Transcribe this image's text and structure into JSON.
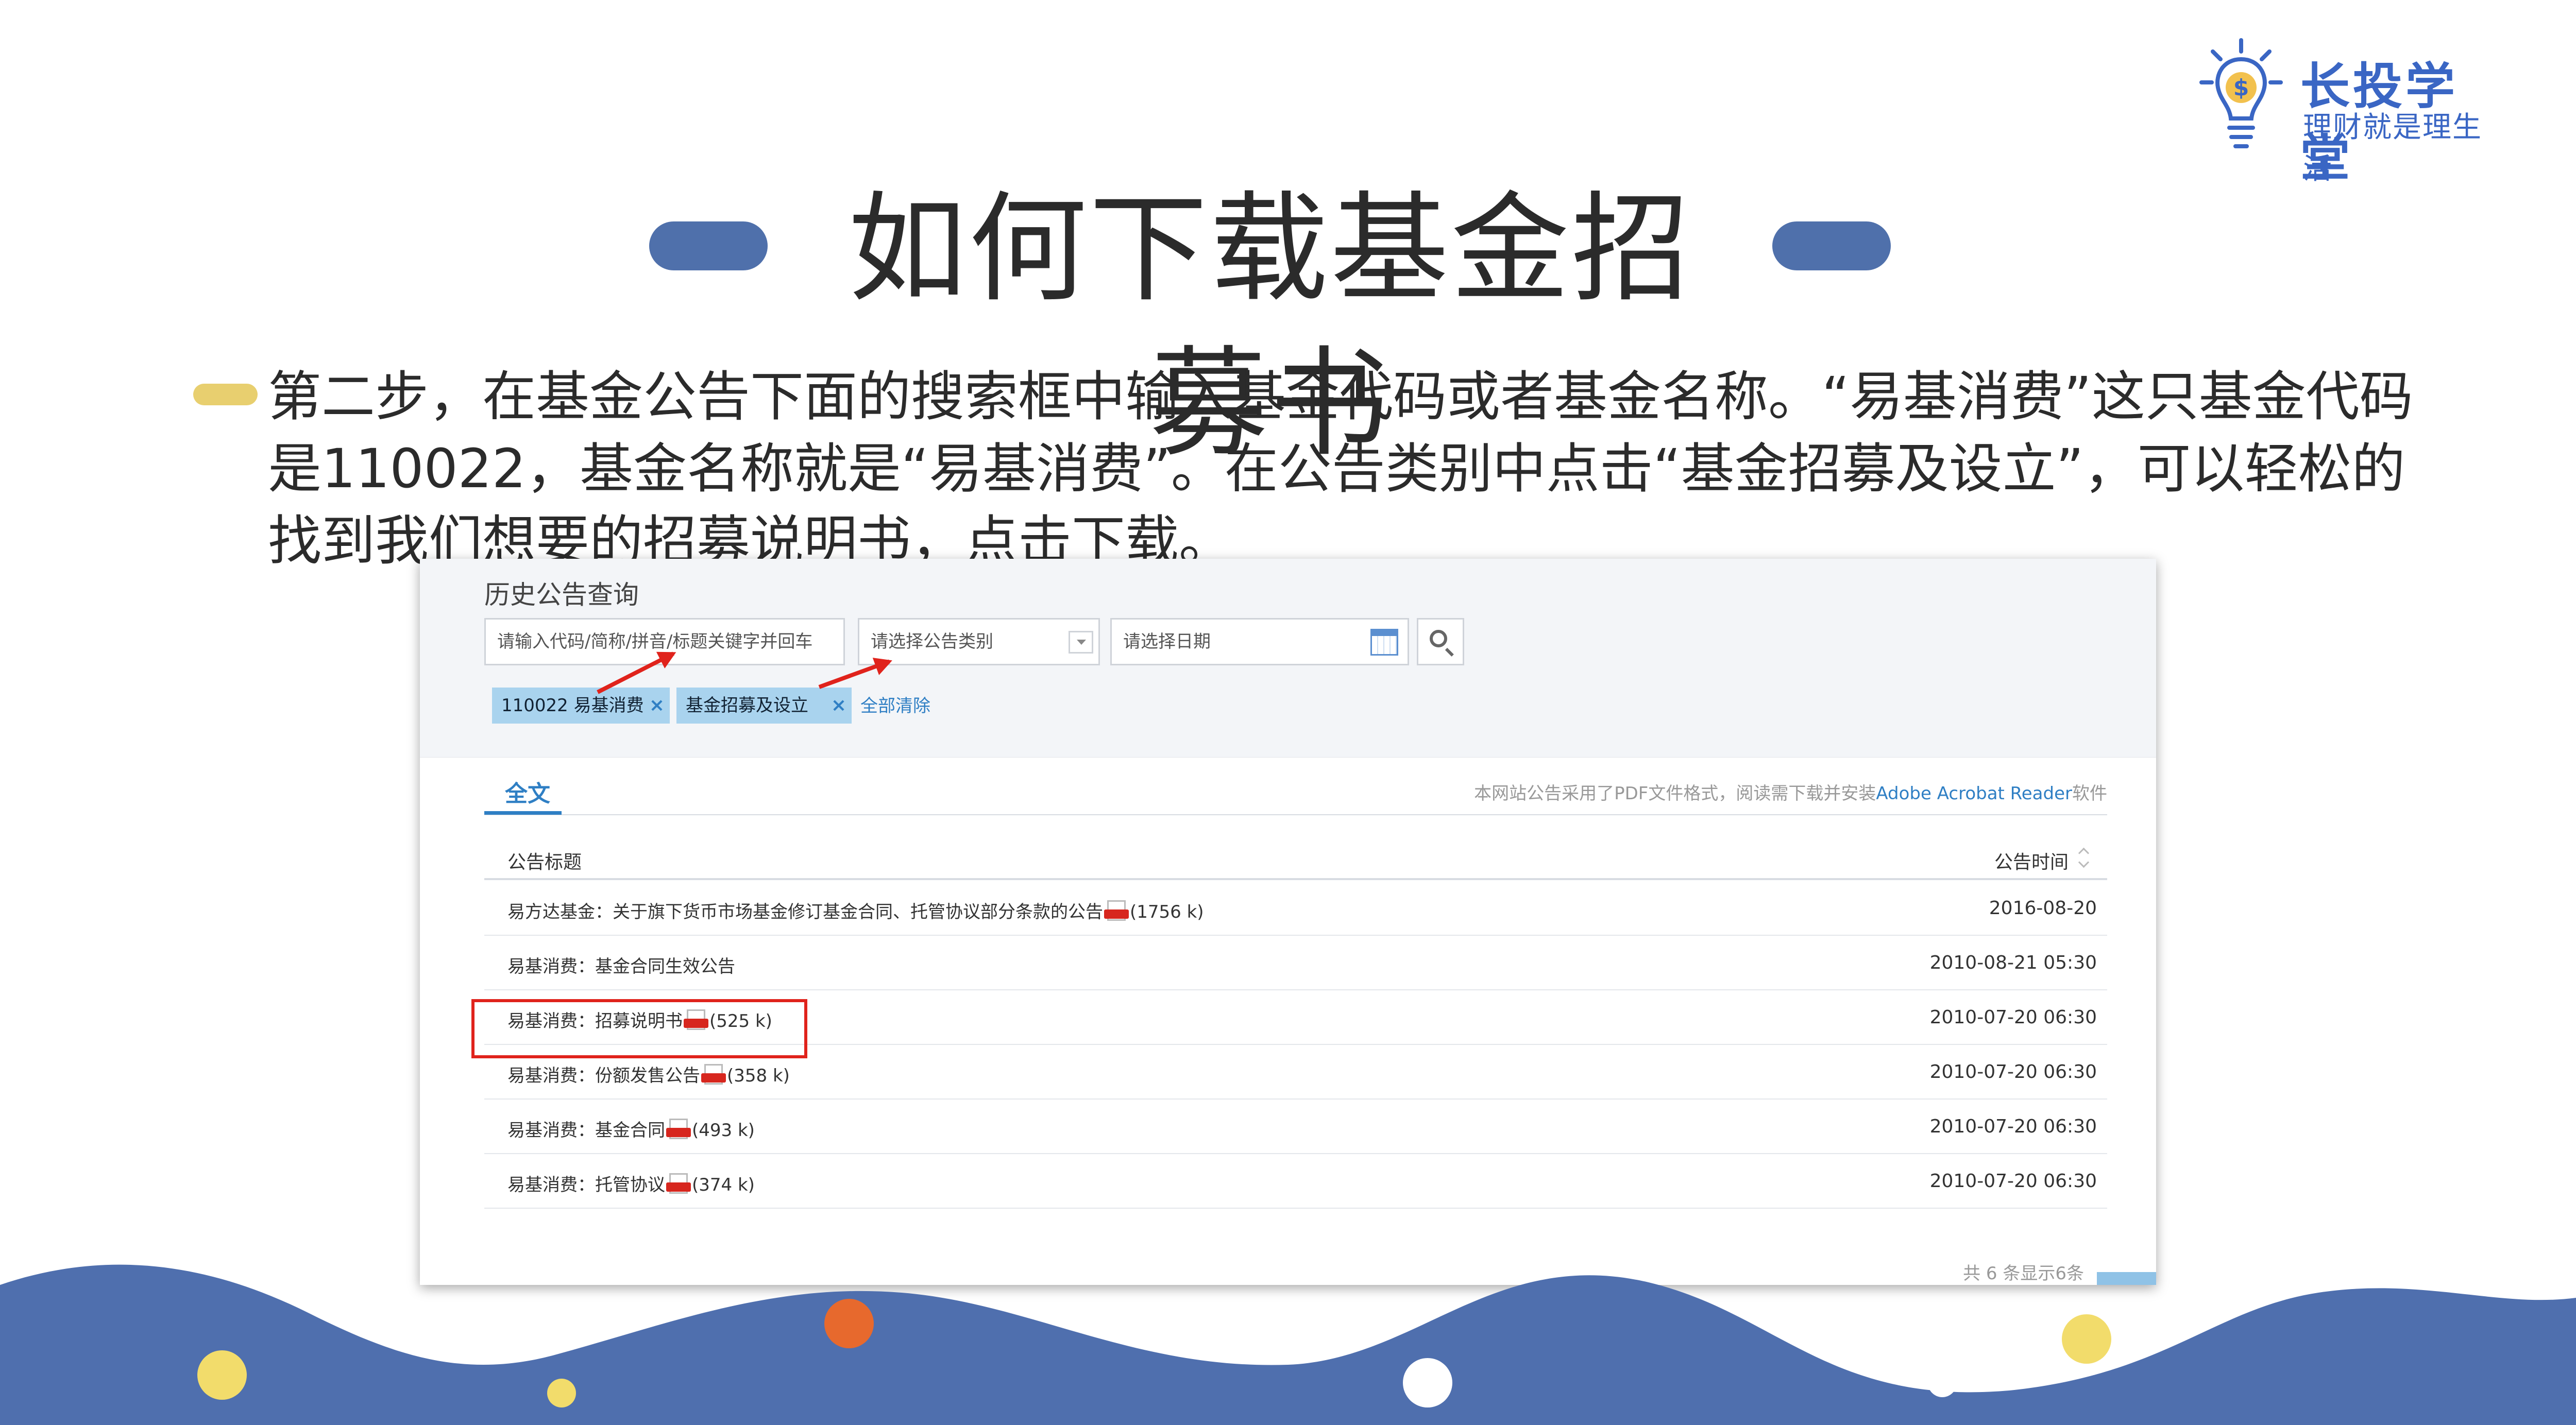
{
  "brand": {
    "name": "长投学堂",
    "slogan": "理财就是理生活"
  },
  "slide": {
    "title": "如何下载基金招募书",
    "intro": "第二步，在基金公告下面的搜索框中输入基金代码或者基金名称。“易基消费”这只基金代码是110022，基金名称就是“易基消费”。在公告类别中点击“基金招募及设立”，可以轻松的找到我们想要的招募说明书，点击下载。"
  },
  "search_panel": {
    "title": "历史公告查询",
    "code_placeholder": "请输入代码/简称/拼音/标题关键字并回车",
    "type_placeholder": "请选择公告类别",
    "date_placeholder": "请选择日期",
    "tags": [
      {
        "label": "110022 易基消费",
        "remove": "×"
      },
      {
        "label": "基金招募及设立",
        "remove": "×"
      }
    ],
    "clear_all": "全部清除"
  },
  "results": {
    "tab": "全文",
    "pdf_note": "本网站公告采用了PDF文件格式，阅读需下载并安装",
    "pdf_note_link": "Adobe Acrobat Reader",
    "pdf_note_suffix": "软件",
    "columns": {
      "title": "公告标题",
      "time": "公告时间"
    },
    "rows": [
      {
        "title": "易方达基金：关于旗下货币市场基金修订基金合同、托管协议部分条款的公告",
        "size": "(1756 k)",
        "time": "2016-08-20"
      },
      {
        "title": "易基消费：基金合同生效公告",
        "size": "",
        "time": "2010-08-21 05:30"
      },
      {
        "title": "易基消费：招募说明书",
        "size": "(525 k)",
        "time": "2010-07-20 06:30"
      },
      {
        "title": "易基消费：份额发售公告",
        "size": "(358 k)",
        "time": "2010-07-20 06:30"
      },
      {
        "title": "易基消费：基金合同",
        "size": "(493 k)",
        "time": "2010-07-20 06:30"
      },
      {
        "title": "易基消费：托管协议",
        "size": "(374 k)",
        "time": "2010-07-20 06:30"
      }
    ],
    "pager": "共 6 条显示6条"
  },
  "colors": {
    "title_pill": "#4f70ab",
    "marker": "#e8cf6f",
    "link": "#2f7fc4",
    "highlight": "#e0231c",
    "wave": "#4f6fae"
  }
}
